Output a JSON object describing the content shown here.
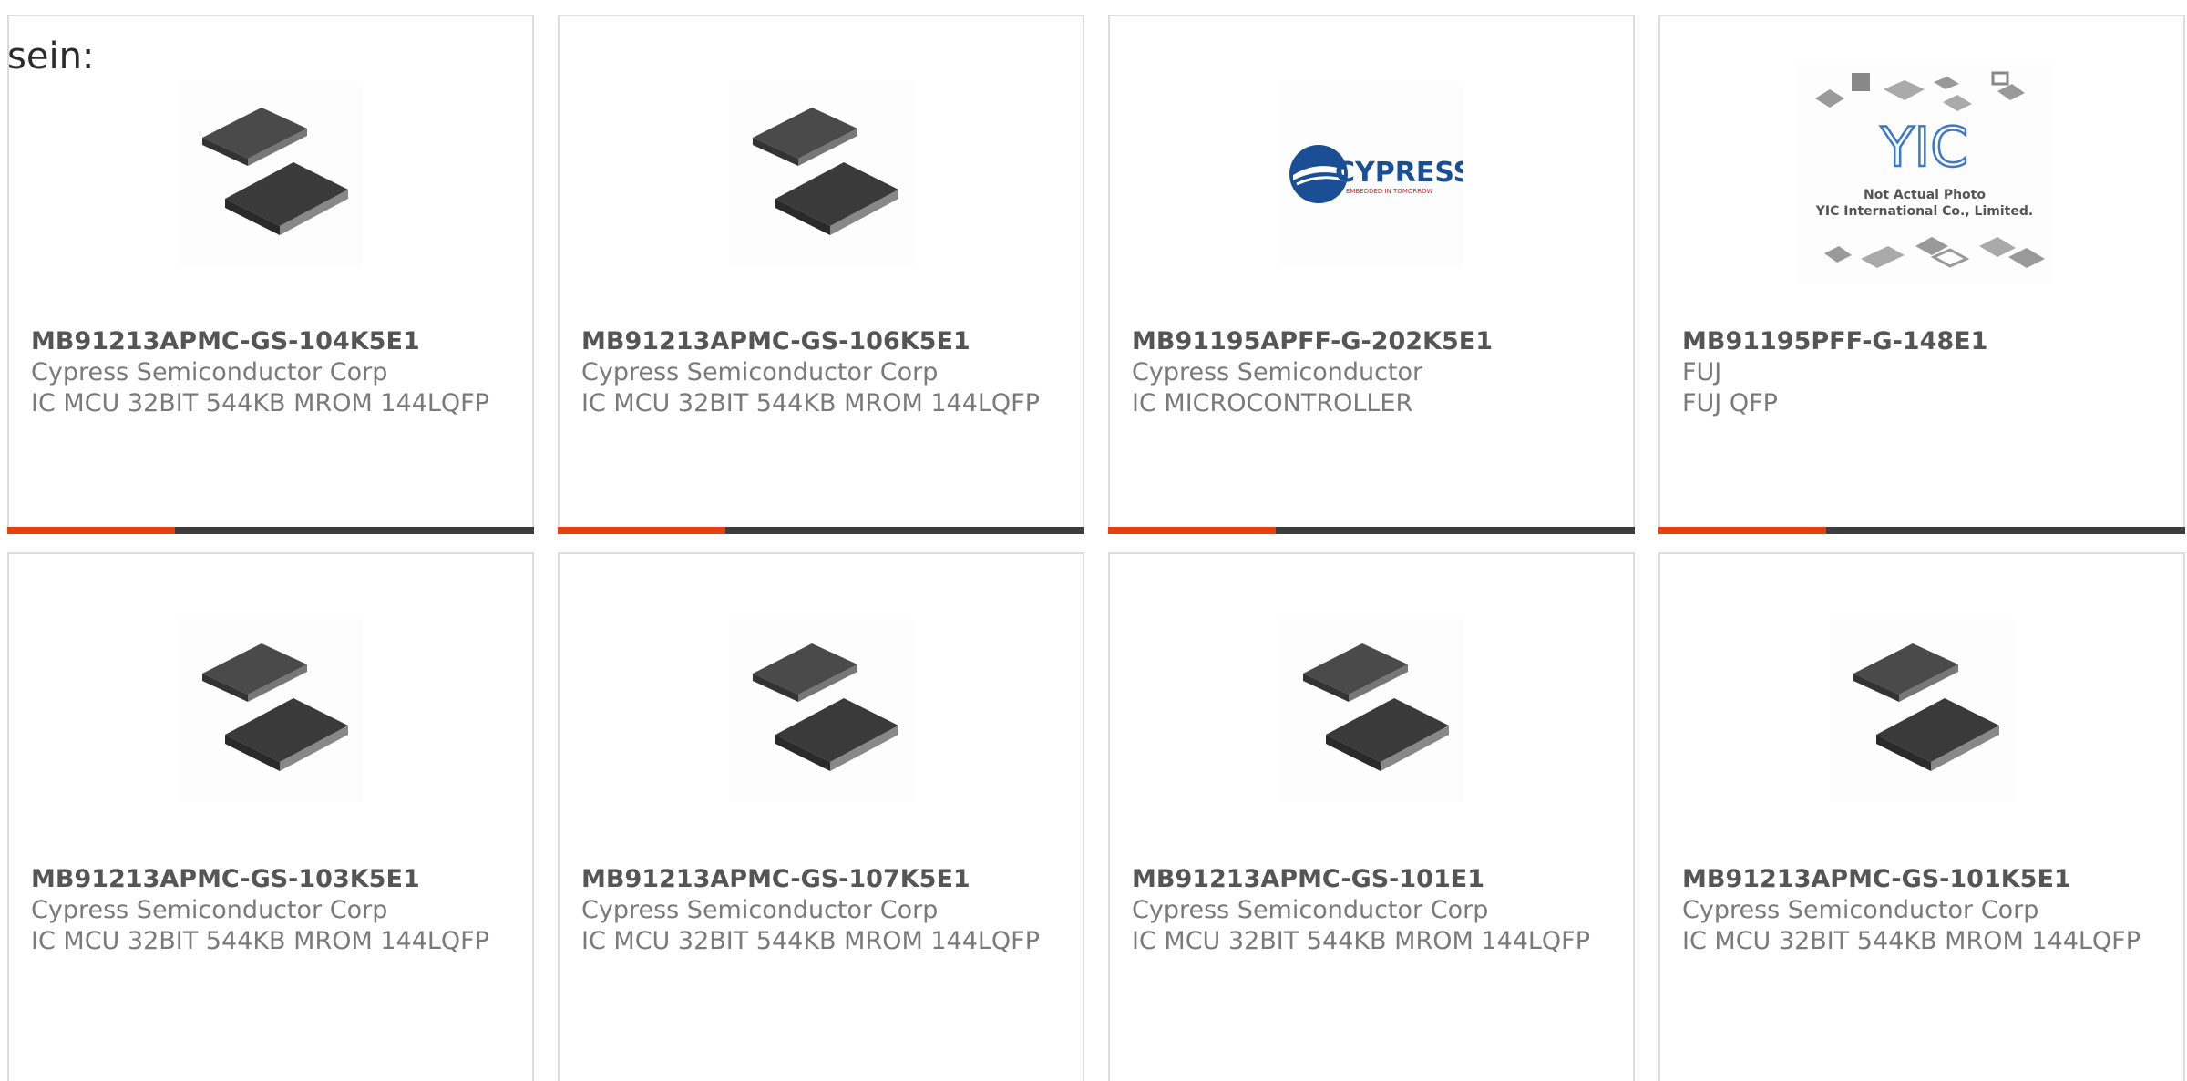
{
  "intro_text": "sein:",
  "colors": {
    "accent": "#e8410f",
    "bar": "#3d3d3d",
    "border": "#dcdcdc",
    "text": "#7a7a7a"
  },
  "products": [
    {
      "part": "MB91213APMC-GS-104K5E1",
      "maker": "Cypress Semiconductor Corp",
      "description": "IC MCU 32BIT 544KB MROM 144LQFP",
      "image": "chip-icon"
    },
    {
      "part": "MB91213APMC-GS-106K5E1",
      "maker": "Cypress Semiconductor Corp",
      "description": "IC MCU 32BIT 544KB MROM 144LQFP",
      "image": "chip-icon"
    },
    {
      "part": "MB91195APFF-G-202K5E1",
      "maker": "Cypress Semiconductor",
      "description": "IC MICROCONTROLLER",
      "image": "cypress-logo",
      "logo_text": "CYPRESS",
      "logo_sub": "EMBEDDED IN TOMORROW"
    },
    {
      "part": "MB91195PFF-G-148E1",
      "maker": "FUJ",
      "description": "FUJ QFP",
      "image": "yic-placeholder",
      "logo_text": "YIC",
      "caption1": "Not Actual Photo",
      "caption2": "YIC International Co., Limited."
    },
    {
      "part": "MB91213APMC-GS-103K5E1",
      "maker": "Cypress Semiconductor Corp",
      "description": "IC MCU 32BIT 544KB MROM 144LQFP",
      "image": "chip-icon"
    },
    {
      "part": "MB91213APMC-GS-107K5E1",
      "maker": "Cypress Semiconductor Corp",
      "description": "IC MCU 32BIT 544KB MROM 144LQFP",
      "image": "chip-icon"
    },
    {
      "part": "MB91213APMC-GS-101E1",
      "maker": "Cypress Semiconductor Corp",
      "description": "IC MCU 32BIT 544KB MROM 144LQFP",
      "image": "chip-icon"
    },
    {
      "part": "MB91213APMC-GS-101K5E1",
      "maker": "Cypress Semiconductor Corp",
      "description": "IC MCU 32BIT 544KB MROM 144LQFP",
      "image": "chip-icon"
    }
  ]
}
